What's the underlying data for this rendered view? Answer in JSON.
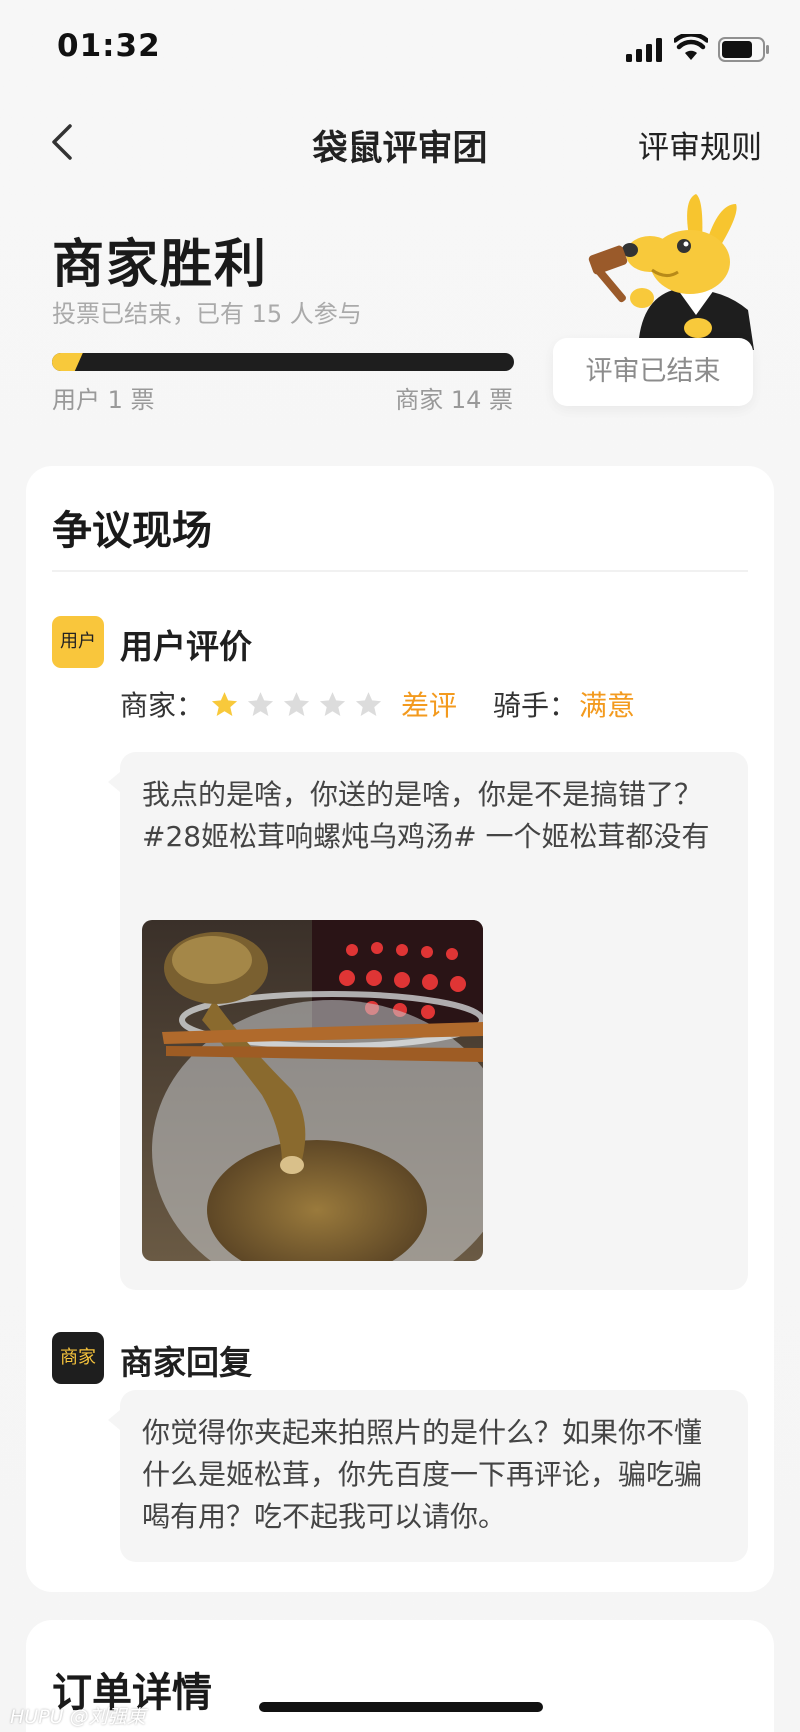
{
  "status_bar": {
    "time": "01:32"
  },
  "nav": {
    "title": "袋鼠评审团",
    "rules": "评审规则"
  },
  "verdict": {
    "result": "商家胜利",
    "info": "投票已结束，已有 15 人参与",
    "user_votes_label": "用户 1 票",
    "merchant_votes_label": "商家 14 票",
    "user_votes": 1,
    "merchant_votes": 14,
    "status_pill": "评审已结束"
  },
  "dispute": {
    "title": "争议现场",
    "user_review": {
      "tag": "用户",
      "title": "用户评价",
      "merchant_label": "商家：",
      "stars_filled": 1,
      "stars_total": 5,
      "merchant_rating": "差评",
      "rider_label": "骑手：",
      "rider_rating": "满意",
      "text": "我点的是啥，你送的是啥，你是不是搞错了？#28姬松茸响螺炖乌鸡汤# 一个姬松茸都没有"
    },
    "merchant_reply": {
      "tag": "商家",
      "title": "商家回复",
      "text": "你觉得你夹起来拍照片的是什么？如果你不懂什么是姬松茸，你先百度一下再评论，骗吃骗喝有用？吃不起我可以请你。"
    }
  },
  "order": {
    "title": "订单详情"
  },
  "watermark": "HUPU @刘强東",
  "colors": {
    "accent_yellow": "#f8c93b",
    "rating_orange": "#f39a1e",
    "dark": "#1e1e1e"
  },
  "icons": [
    "signal-icon",
    "wifi-icon",
    "battery-icon",
    "back-arrow-icon",
    "kangaroo-judge-mascot",
    "star-icon"
  ]
}
